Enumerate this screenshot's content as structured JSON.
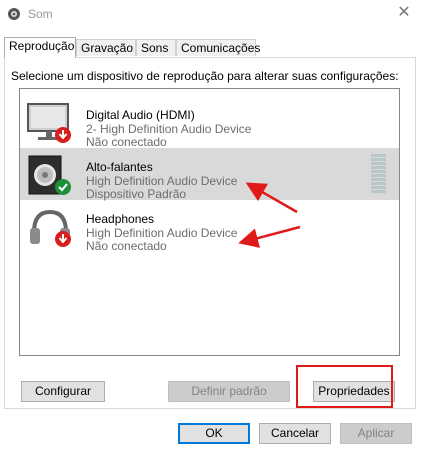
{
  "window": {
    "title": "Som",
    "close_glyph": "✕"
  },
  "tabs": [
    {
      "label": "Reprodução",
      "active": true
    },
    {
      "label": "Gravação",
      "active": false
    },
    {
      "label": "Sons",
      "active": false
    },
    {
      "label": "Comunicações",
      "active": false
    }
  ],
  "instructions": "Selecione um dispositivo de reprodução para alterar suas configurações:",
  "devices": [
    {
      "name": "Digital Audio (HDMI)",
      "line1": "2- High Definition Audio Device",
      "line2": "Não conectado",
      "icon": "monitor-icon",
      "status": "disconnected",
      "selected": false
    },
    {
      "name": "Alto-falantes",
      "line1": "High Definition Audio Device",
      "line2": "Dispositivo Padrão",
      "icon": "speaker-icon",
      "status": "default",
      "selected": true
    },
    {
      "name": "Headphones",
      "line1": "High Definition Audio Device",
      "line2": "Não conectado",
      "icon": "headphones-icon",
      "status": "disconnected",
      "selected": false
    }
  ],
  "buttons": {
    "configure": "Configurar",
    "set_default": "Definir padrão",
    "properties": "Propriedades",
    "ok": "OK",
    "cancel": "Cancelar",
    "apply": "Aplicar"
  },
  "colors": {
    "selection": "#d9d9d9",
    "annotation_red": "#e01919",
    "status_green": "#1e8f3a",
    "status_red": "#d81f1f"
  }
}
